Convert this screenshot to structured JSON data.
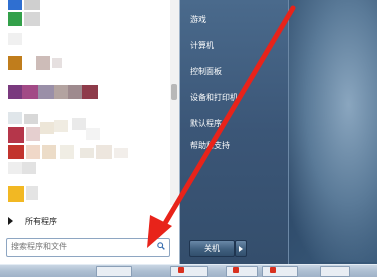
{
  "start_menu": {
    "all_programs_label": "所有程序",
    "search_placeholder": "搜索程序和文件",
    "right_items": [
      "游戏",
      "计算机",
      "控制面板",
      "设备和打印机",
      "默认程序",
      "帮助和支持"
    ],
    "shutdown_label": "关机"
  },
  "colors": {
    "annotation_arrow": "#e8231a",
    "right_pane": "#3b5677"
  },
  "icons": {
    "search": "search-icon",
    "all_programs_arrow": "triangle-right-icon",
    "shutdown_options": "triangle-right-icon"
  }
}
